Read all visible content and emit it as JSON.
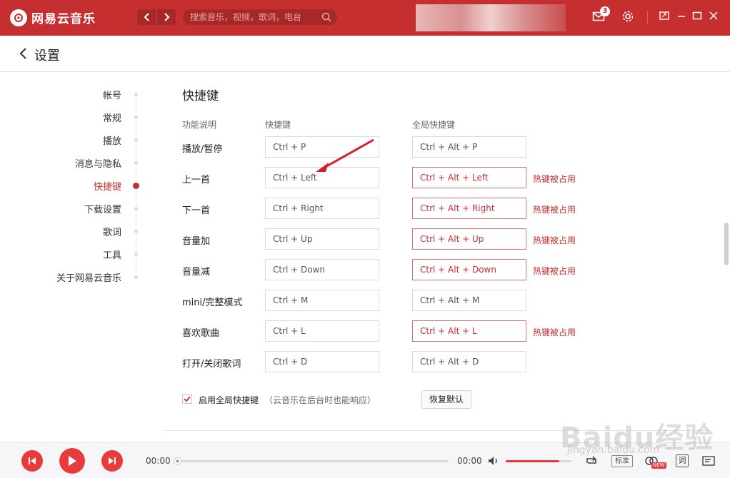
{
  "app": {
    "name": "网易云音乐",
    "search_placeholder": "搜索音乐，视频，歌词，电台",
    "message_count": "3",
    "brand_color": "#c62f2f"
  },
  "header": {
    "title": "设置"
  },
  "sidebar": {
    "items": [
      {
        "label": "帐号",
        "active": false
      },
      {
        "label": "常规",
        "active": false
      },
      {
        "label": "播放",
        "active": false
      },
      {
        "label": "消息与隐私",
        "active": false
      },
      {
        "label": "快捷键",
        "active": true
      },
      {
        "label": "下载设置",
        "active": false
      },
      {
        "label": "歌词",
        "active": false
      },
      {
        "label": "工具",
        "active": false
      },
      {
        "label": "关于网易云音乐",
        "active": false
      }
    ]
  },
  "shortcuts": {
    "section_title": "快捷键",
    "col_function": "功能说明",
    "col_shortcut": "快捷键",
    "col_global": "全局快捷键",
    "conflict_text": "热键被占用",
    "rows": [
      {
        "label": "播放/暂停",
        "key": "Ctrl + P",
        "global": "Ctrl + Alt + P",
        "conflict": false
      },
      {
        "label": "上一首",
        "key": "Ctrl + Left",
        "global": "Ctrl + Alt + Left",
        "conflict": true
      },
      {
        "label": "下一首",
        "key": "Ctrl + Right",
        "global": "Ctrl + Alt + Right",
        "conflict": true
      },
      {
        "label": "音量加",
        "key": "Ctrl + Up",
        "global": "Ctrl + Alt + Up",
        "conflict": true
      },
      {
        "label": "音量减",
        "key": "Ctrl + Down",
        "global": "Ctrl + Alt + Down",
        "conflict": true
      },
      {
        "label": "mini/完整模式",
        "key": "Ctrl + M",
        "global": "Ctrl + Alt + M",
        "conflict": false
      },
      {
        "label": "喜欢歌曲",
        "key": "Ctrl + L",
        "global": "Ctrl + Alt + L",
        "conflict": true
      },
      {
        "label": "打开/关闭歌词",
        "key": "Ctrl + D",
        "global": "Ctrl + Alt + D",
        "conflict": false
      }
    ],
    "enable_global_label": "启用全局快捷键",
    "enable_global_hint": "（云音乐在后台时也能响应）",
    "enable_global_checked": true,
    "restore_default_label": "恢复默认"
  },
  "player": {
    "current_time": "00:00",
    "total_time": "00:00",
    "progress": 0,
    "volume": 0.82,
    "quality_label": "标准",
    "lyric_label": "词",
    "new_tag": "NEW"
  },
  "watermark": {
    "text": "Baidu经验",
    "sub": "jingyan.baidu.com"
  }
}
